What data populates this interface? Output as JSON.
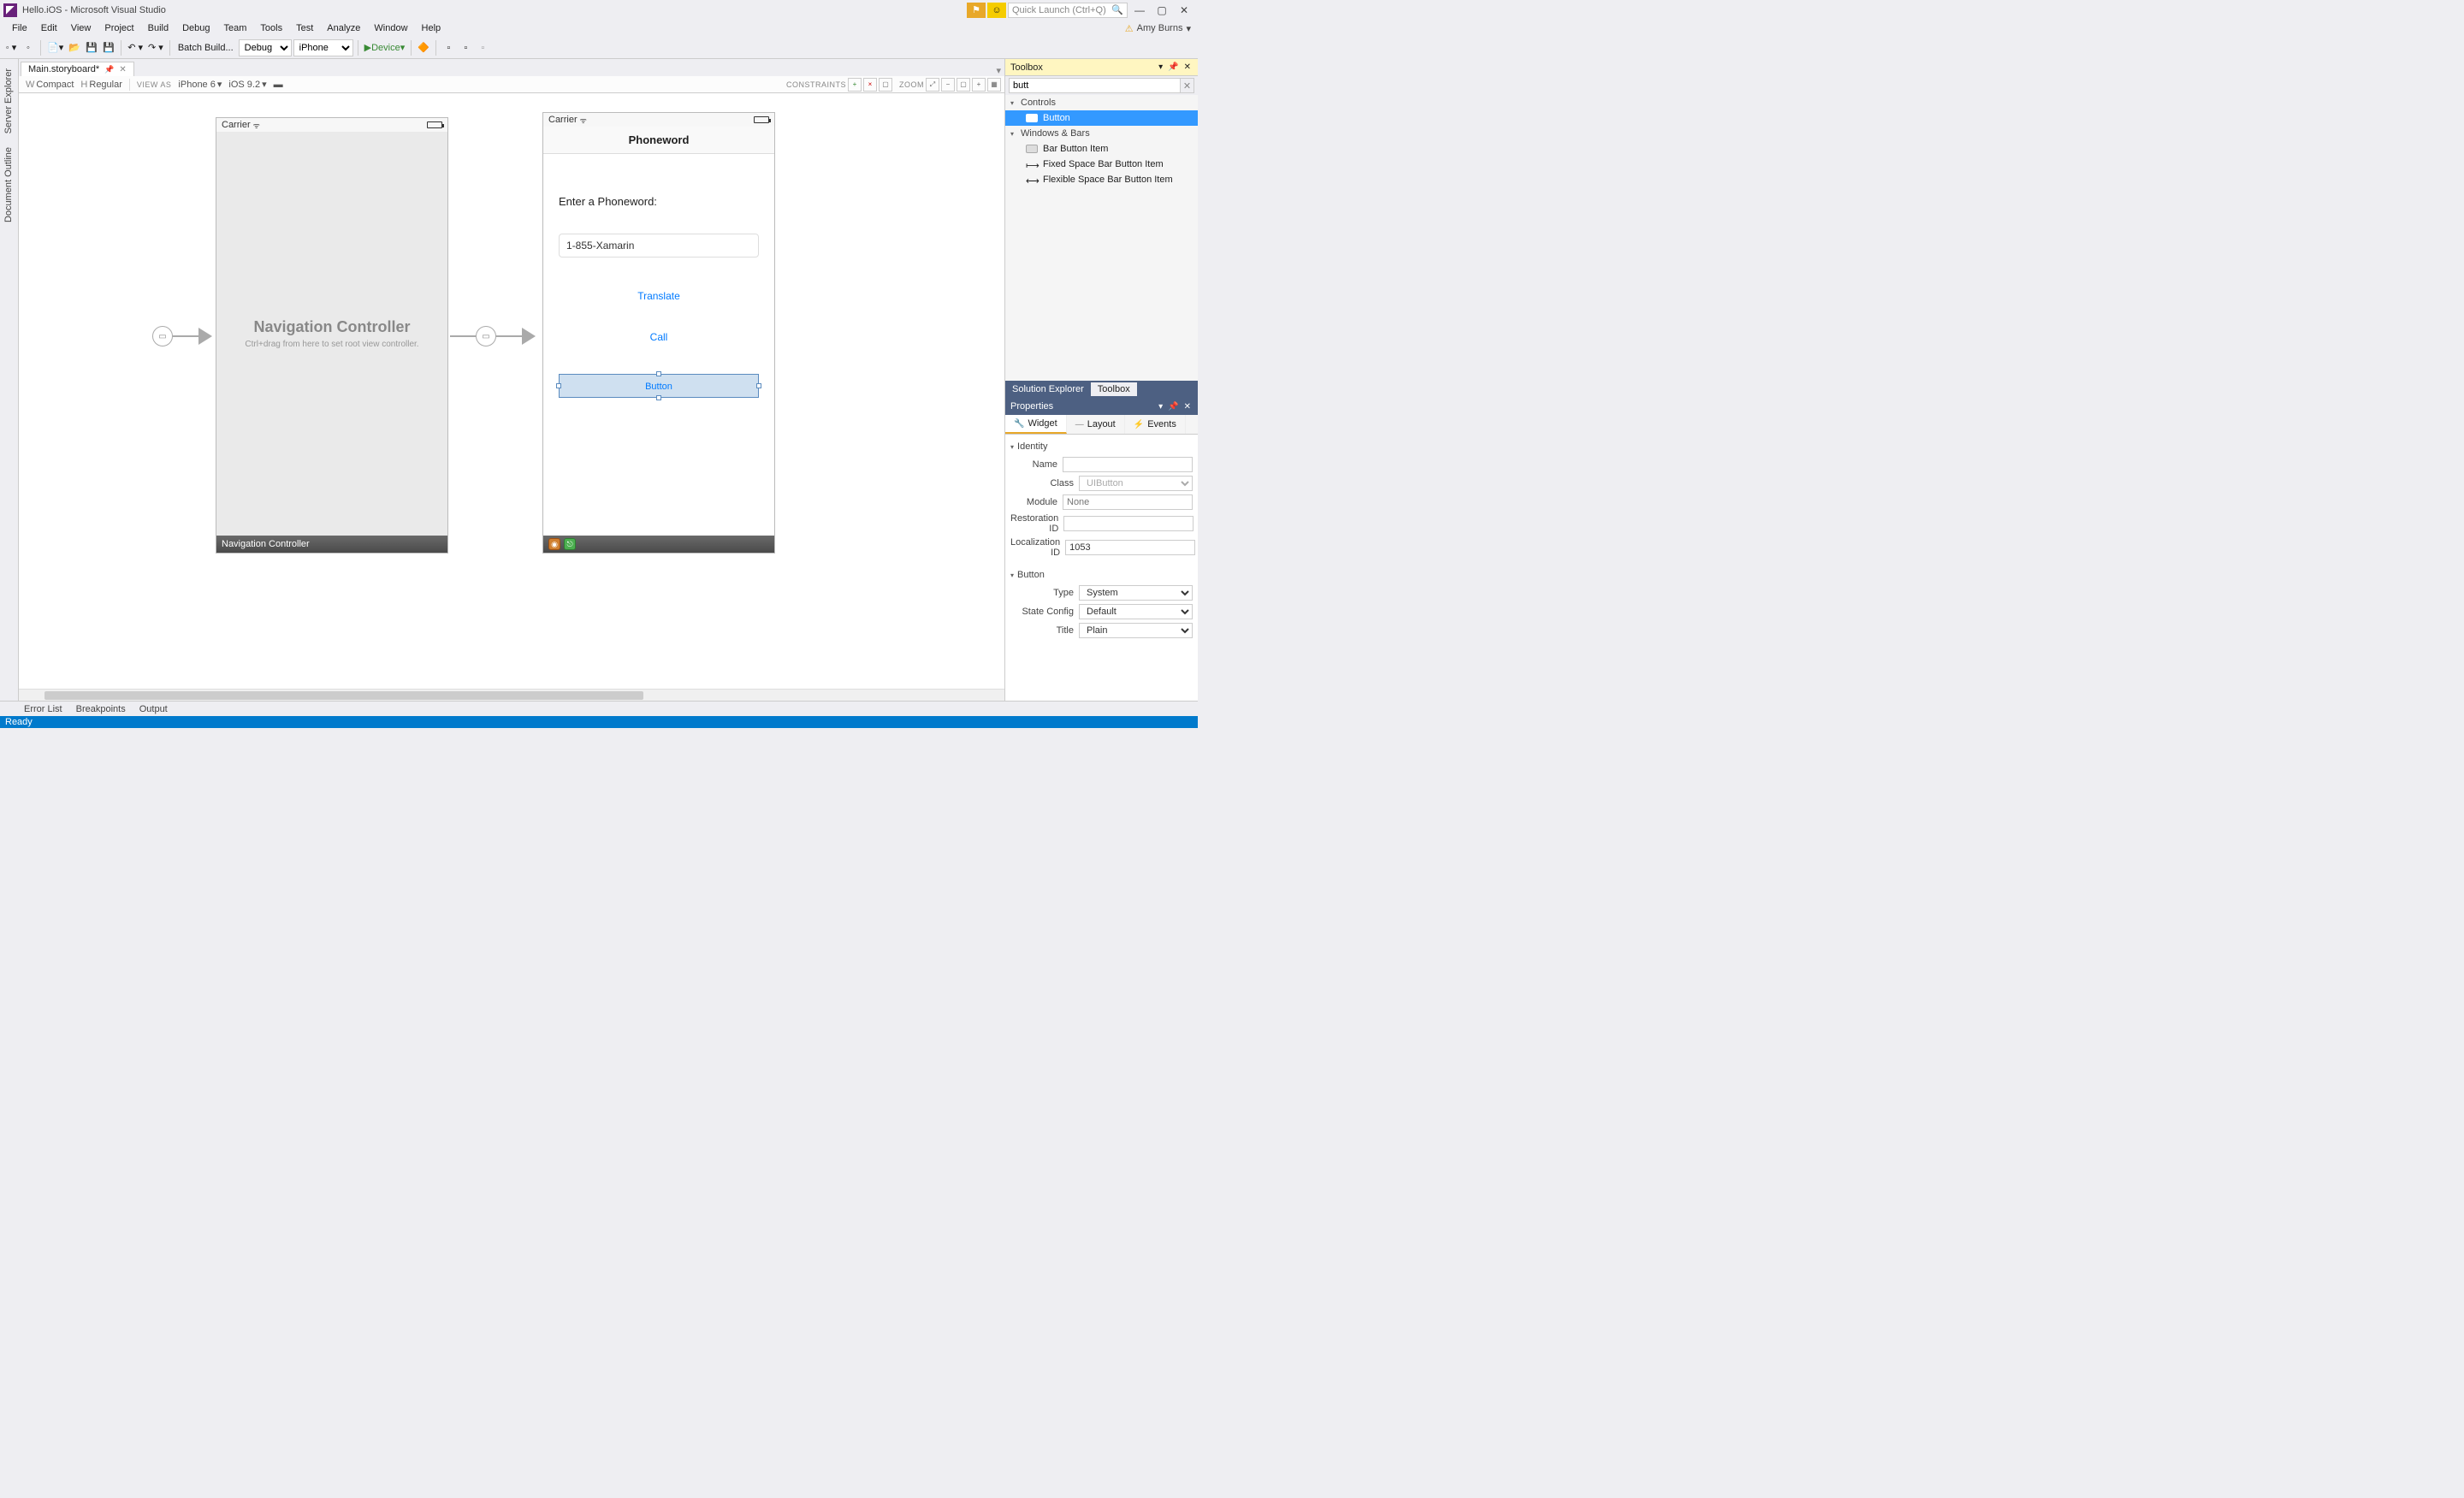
{
  "title": "Hello.iOS - Microsoft Visual Studio",
  "quick_launch_placeholder": "Quick Launch (Ctrl+Q)",
  "user_name": "Amy Burns",
  "menu": [
    "File",
    "Edit",
    "View",
    "Project",
    "Build",
    "Debug",
    "Team",
    "Tools",
    "Test",
    "Analyze",
    "Window",
    "Help"
  ],
  "toolbar": {
    "batch_build": "Batch Build...",
    "config": "Debug",
    "platform": "iPhone",
    "device": "Device"
  },
  "left_tabs": [
    "Server Explorer",
    "Document Outline"
  ],
  "document": {
    "tab_name": "Main.storyboard*",
    "designer_bar": {
      "size_w": "WCompact",
      "size_h": "HRegular",
      "view_as_label": "VIEW AS",
      "device": "iPhone 6",
      "ios": "iOS 9.2",
      "constraints_label": "CONSTRAINTS",
      "zoom_label": "ZOOM"
    }
  },
  "storyboard": {
    "nav_controller": {
      "carrier": "Carrier",
      "title": "Navigation Controller",
      "subtitle": "Ctrl+drag from here to set root view controller.",
      "footer": "Navigation Controller"
    },
    "phoneword": {
      "carrier": "Carrier",
      "nav_title": "Phoneword",
      "label": "Enter a Phoneword:",
      "textfield": "1-855-Xamarin",
      "translate_btn": "Translate",
      "call_btn": "Call",
      "new_btn": "Button"
    }
  },
  "toolbox": {
    "title": "Toolbox",
    "search_value": "butt",
    "groups": [
      {
        "name": "Controls",
        "items": [
          {
            "label": "Button",
            "selected": true
          }
        ]
      },
      {
        "name": "Windows & Bars",
        "items": [
          {
            "label": "Bar Button Item"
          },
          {
            "label": "Fixed Space Bar Button Item"
          },
          {
            "label": "Flexible Space Bar Button Item"
          }
        ]
      }
    ],
    "bottom_tabs": [
      "Solution Explorer",
      "Toolbox"
    ],
    "active_bottom_tab": "Toolbox"
  },
  "properties": {
    "title": "Properties",
    "tabs": [
      "Widget",
      "Layout",
      "Events"
    ],
    "active_tab": "Widget",
    "identity": {
      "header": "Identity",
      "name": "",
      "class_placeholder": "UIButton",
      "module_placeholder": "None",
      "restoration_id": "",
      "localization_id": "1053",
      "labels": {
        "name": "Name",
        "class": "Class",
        "module": "Module",
        "restoration": "Restoration ID",
        "localization": "Localization ID"
      }
    },
    "button": {
      "header": "Button",
      "type": "System",
      "state_config": "Default",
      "title": "Plain",
      "labels": {
        "type": "Type",
        "state_config": "State Config",
        "title": "Title"
      }
    }
  },
  "bottom_tabs": [
    "Error List",
    "Breakpoints",
    "Output"
  ],
  "status": "Ready"
}
